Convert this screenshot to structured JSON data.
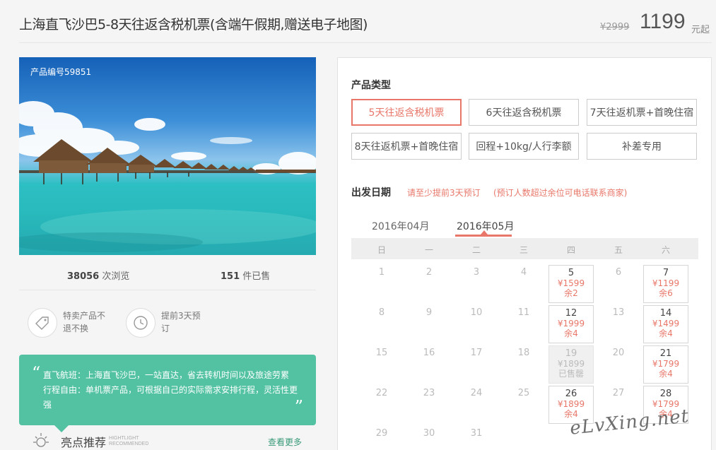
{
  "header": {
    "title": "上海直飞沙巴5-8天往返含税机票(含端午假期,赠送电子地图)",
    "original_price": "¥2999",
    "price": "1199",
    "price_unit": "元起"
  },
  "photo": {
    "product_no": "产品编号59851"
  },
  "stats": {
    "views_count": "38056",
    "views_label": "次浏览",
    "sold_count": "151",
    "sold_label": "件已售"
  },
  "features": [
    {
      "icon": "tag-icon",
      "text": "特卖产品不退不换"
    },
    {
      "icon": "clock-icon",
      "text": "提前3天预订"
    }
  ],
  "promo": {
    "line1": "直飞航班：上海直飞沙巴，一站直达，省去转机时间以及旅途劳累",
    "line2": "行程自由：单机票产品，可根据自己的实际需求安排行程，灵活性更强"
  },
  "highlight": {
    "title": "亮点推荐",
    "en1": "HIGHTLIGHT",
    "en2": "RECOMMENDED",
    "more": "查看更多"
  },
  "booking": {
    "type_title": "产品类型",
    "types": [
      "5天往返含税机票",
      "6天往返含税机票",
      "7天往返机票+首晚住宿",
      "8天往返机票+首晚住宿",
      "回程+10kg/人行李额",
      "补差专用"
    ],
    "active_type": 0,
    "date_title": "出发日期",
    "note1": "请至少提前3天预订",
    "note2": "(预订人数超过余位可电话联系商家)",
    "months": [
      "2016年04月",
      "2016年05月"
    ],
    "active_month": 1,
    "weekdays": [
      "日",
      "一",
      "二",
      "三",
      "四",
      "五",
      "六"
    ]
  },
  "calendar": [
    {
      "day": "1"
    },
    {
      "day": "2"
    },
    {
      "day": "3"
    },
    {
      "day": "4"
    },
    {
      "day": "5",
      "price": "¥1599",
      "remain": "余2",
      "status": "avail"
    },
    {
      "day": "6"
    },
    {
      "day": "7",
      "price": "¥1199",
      "remain": "余6",
      "status": "avail"
    },
    {
      "day": "8"
    },
    {
      "day": "9"
    },
    {
      "day": "10"
    },
    {
      "day": "11"
    },
    {
      "day": "12",
      "price": "¥1999",
      "remain": "余4",
      "status": "avail"
    },
    {
      "day": "13"
    },
    {
      "day": "14",
      "price": "¥1499",
      "remain": "余4",
      "status": "avail"
    },
    {
      "day": "15"
    },
    {
      "day": "16"
    },
    {
      "day": "17"
    },
    {
      "day": "18"
    },
    {
      "day": "19",
      "price": "¥1899",
      "remain": "已售罄",
      "status": "soldout"
    },
    {
      "day": "20"
    },
    {
      "day": "21",
      "price": "¥1799",
      "remain": "余4",
      "status": "avail"
    },
    {
      "day": "22"
    },
    {
      "day": "23"
    },
    {
      "day": "24"
    },
    {
      "day": "25"
    },
    {
      "day": "26",
      "price": "¥1899",
      "remain": "余4",
      "status": "avail"
    },
    {
      "day": "27"
    },
    {
      "day": "28",
      "price": "¥1799",
      "remain": "余4",
      "status": "avail"
    },
    {
      "day": "29"
    },
    {
      "day": "30"
    },
    {
      "day": "31"
    }
  ],
  "watermark": "eLvXing.net",
  "colors": {
    "accent": "#e8776a",
    "green": "#52c2a2",
    "link": "#3a9a7a"
  }
}
